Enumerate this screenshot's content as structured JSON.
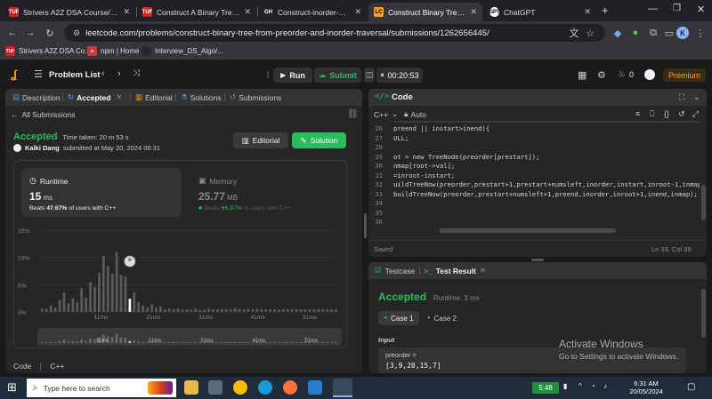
{
  "browser": {
    "tabs": [
      {
        "title": "Strivers A2Z DSA Course/She",
        "favicon": "TUF"
      },
      {
        "title": "Construct A Binary Tree from",
        "favicon": "TUF"
      },
      {
        "title": "Construct-inorder-preorder",
        "favicon": "GH"
      },
      {
        "title": "Construct Binary Tree from P",
        "favicon": "LC"
      },
      {
        "title": "ChatGPT",
        "favicon": "GPT"
      }
    ],
    "url": "leetcode.com/problems/construct-binary-tree-from-preorder-and-inorder-traversal/submissions/1262656445/",
    "profile_letter": "K",
    "bookmarks": [
      "Strivers A2Z DSA Co...",
      "npm | Home",
      "Interview_DS_Algo/..."
    ]
  },
  "lc_nav": {
    "problem_list": "Problem List",
    "run": "Run",
    "submit": "Submit",
    "timer": "00:20:53",
    "streak": "0",
    "premium": "Premium"
  },
  "left_tabs": {
    "description": "Description",
    "accepted": "Accepted",
    "editorial": "Editorial",
    "solutions": "Solutions",
    "submissions": "Submissions"
  },
  "submission": {
    "all_submissions": "All Submissions",
    "status": "Accepted",
    "time_taken": "Time taken: 20 m 53 s",
    "user": "Kalki Dang",
    "submitted_at": "submitted at May 20, 2024 06:31",
    "editorial_btn": "Editorial",
    "solution_btn": "Solution",
    "runtime": {
      "label": "Runtime",
      "value": "15",
      "unit": "ms",
      "beats_prefix": "Beats",
      "beats_value": "47.67%",
      "beats_suffix": "of users with C++"
    },
    "memory": {
      "label": "Memory",
      "value": "25.77",
      "unit": "MB",
      "beats_prefix": "Beats",
      "beats_value": "65.87%",
      "beats_suffix": "of users with C++"
    },
    "footer_code": "Code",
    "footer_lang": "C++"
  },
  "chart_data": {
    "type": "bar",
    "y_ticks": [
      "15%",
      "10%",
      "5%",
      "0%"
    ],
    "x_ticks": [
      "11ms",
      "21ms",
      "31ms",
      "41ms",
      "51ms"
    ],
    "ylim": [
      0,
      15
    ],
    "values": [
      0.6,
      0.6,
      1.2,
      0.8,
      2.2,
      3.6,
      1.6,
      2.5,
      1.8,
      4.4,
      2.6,
      5.5,
      4.6,
      7.2,
      10.3,
      8.4,
      7.0,
      11.0,
      6.8,
      6.5,
      2.4,
      3.6,
      1.8,
      1.2,
      0.8,
      1.4,
      0.8,
      1.0,
      0.5,
      0.6,
      0.5,
      0.6,
      0.4,
      0.5,
      0.4,
      0.6,
      0.4,
      0.4,
      0.6,
      0.5,
      0.5,
      0.6,
      0.5,
      0.5,
      0.7,
      0.5,
      0.5,
      0.6,
      0.5,
      0.6,
      0.5,
      0.5,
      0.5,
      0.5,
      0.5,
      0.5,
      0.5,
      0.5,
      0.5,
      0.5,
      0.5,
      0.5,
      0.5,
      0.5,
      0.5,
      0.5,
      0.5,
      0.5
    ],
    "highlight_index": 20,
    "highlight_value": 7.0,
    "minimap_ticks": [
      "11ms",
      "21ms",
      "31ms",
      "41ms",
      "51ms"
    ]
  },
  "code_panel": {
    "title": "Code",
    "lang": "C++",
    "auto": "Auto",
    "status": "Saved",
    "cursor": "Ln 33, Col 99",
    "lines": [
      {
        "n": "26",
        "text": "preend || instart>inend){"
      },
      {
        "n": "27",
        "text": "ULL;"
      },
      {
        "n": "28",
        "text": ""
      },
      {
        "n": "29",
        "text": "ot = new TreeNode(preorder[prestart]);"
      },
      {
        "n": "30",
        "text": "nmap[root->val];"
      },
      {
        "n": "31",
        "text": "=inroot-instart;"
      },
      {
        "n": "32",
        "text": "uildTreeNow(preorder,prestart+1,prestart+numsleft,inorder,instart,inroot-1,inmap);"
      },
      {
        "n": "33",
        "text": "buildTreeNow(preorder,prestart+numsleft+1,preend,inorder,inroot+1,inend,inmap);"
      },
      {
        "n": "34",
        "text": ""
      },
      {
        "n": "35",
        "text": ""
      },
      {
        "n": "36",
        "text": ""
      }
    ]
  },
  "test_panel": {
    "testcase": "Testcase",
    "test_result": "Test Result",
    "status": "Accepted",
    "runtime": "Runtime: 3 ms",
    "case1": "Case 1",
    "case2": "Case 2",
    "input_label": "Input",
    "param": "preorder =",
    "param_value": "[3,9,20,15,7]"
  },
  "watermark": {
    "title": "Activate Windows",
    "subtitle": "Go to Settings to activate Windows."
  },
  "taskbar": {
    "search_placeholder": "Type here to search",
    "battery": "5:48",
    "time": "6:31 AM",
    "date": "20/05/2024"
  }
}
